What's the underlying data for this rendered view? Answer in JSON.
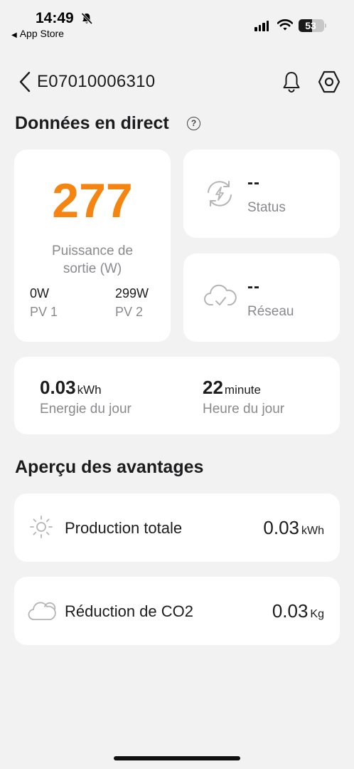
{
  "status_bar": {
    "time": "14:49",
    "back_app": "App Store",
    "battery": "53",
    "icons": [
      "bell-slash-icon",
      "signal-icon",
      "wifi-icon",
      "battery-icon"
    ]
  },
  "header": {
    "device_id": "E07010006310",
    "icons": [
      "chevron-left-icon",
      "bell-icon",
      "hexagon-settings-icon"
    ]
  },
  "live": {
    "title": "Données en direct",
    "help_icon": "?",
    "power": {
      "value": "277",
      "label_line1": "Puissance de",
      "label_line2": "sortie (W)",
      "pv1_value": "0W",
      "pv1_label": "PV 1",
      "pv2_value": "299W",
      "pv2_label": "PV 2"
    },
    "status": {
      "value": "--",
      "label": "Status",
      "icon": "sync-lightning-icon"
    },
    "network": {
      "value": "--",
      "label": "Réseau",
      "icon": "cloud-check-icon"
    },
    "daily": {
      "energy_value": "0.03",
      "energy_unit": "kWh",
      "energy_label": "Energie du jour",
      "hours_value": "22",
      "hours_unit": "minute",
      "hours_label": "Heure du jour"
    }
  },
  "benefits": {
    "title": "Aperçu des avantages",
    "items": [
      {
        "label": "Production totale",
        "value": "0.03",
        "unit": "kWh",
        "icon": "sun-icon"
      },
      {
        "label": "Réduction de CO2",
        "value": "0.03",
        "unit": "Kg",
        "icon": "cloud-icon"
      }
    ]
  },
  "colors": {
    "accent": "#f58410",
    "background": "#f2f2f2",
    "card": "#ffffff",
    "muted": "#8a8a8e"
  }
}
